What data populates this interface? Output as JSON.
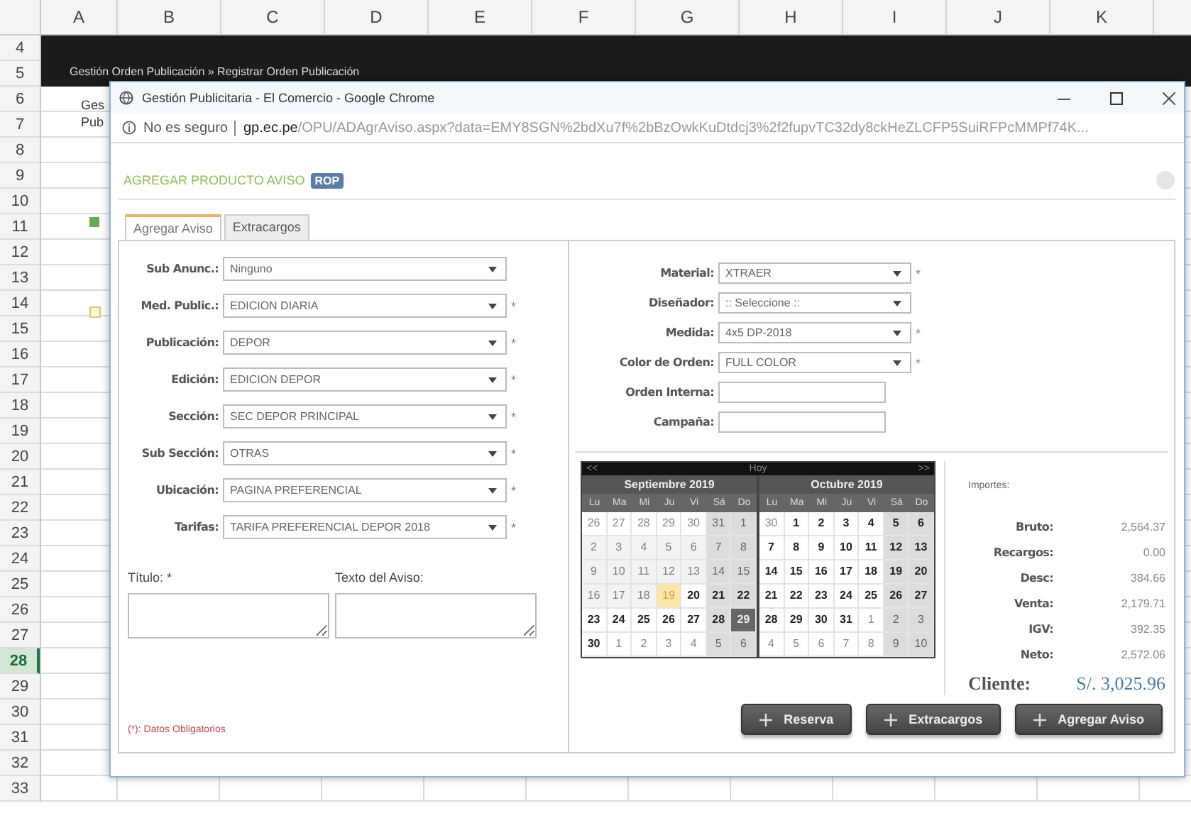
{
  "sheet": {
    "columns": [
      "A",
      "B",
      "C",
      "D",
      "E",
      "F",
      "G",
      "H",
      "I",
      "J",
      "K"
    ],
    "rows": [
      {
        "label": "4",
        "selected": false
      },
      {
        "label": "5",
        "selected": false
      },
      {
        "label": "6",
        "selected": false
      },
      {
        "label": "7",
        "selected": false
      },
      {
        "label": "8",
        "selected": false
      },
      {
        "label": "9",
        "selected": false
      },
      {
        "label": "10",
        "selected": false
      },
      {
        "label": "11",
        "selected": false
      },
      {
        "label": "12",
        "selected": false
      },
      {
        "label": "13",
        "selected": false
      },
      {
        "label": "14",
        "selected": false
      },
      {
        "label": "15",
        "selected": false
      },
      {
        "label": "16",
        "selected": false
      },
      {
        "label": "17",
        "selected": false
      },
      {
        "label": "18",
        "selected": false
      },
      {
        "label": "19",
        "selected": false
      },
      {
        "label": "20",
        "selected": false
      },
      {
        "label": "21",
        "selected": false
      },
      {
        "label": "22",
        "selected": false
      },
      {
        "label": "23",
        "selected": false
      },
      {
        "label": "24",
        "selected": false
      },
      {
        "label": "25",
        "selected": false
      },
      {
        "label": "26",
        "selected": false
      },
      {
        "label": "27",
        "selected": false
      },
      {
        "label": "28",
        "selected": true
      },
      {
        "label": "29",
        "selected": false
      },
      {
        "label": "30",
        "selected": false
      },
      {
        "label": "31",
        "selected": false
      },
      {
        "label": "32",
        "selected": false
      },
      {
        "label": "33",
        "selected": false
      }
    ]
  },
  "background_page": {
    "breadcrumb": "Gestión Orden Publicación » Registrar Orden Publicación",
    "lines": [
      "Ges",
      "Pub"
    ]
  },
  "browser": {
    "title": "Gestión Publicitaria - El Comercio - Google Chrome",
    "security": "No es seguro",
    "url_host": "gp.ec.pe",
    "url_path": "/OPU/ADAgrAviso.aspx?data=EMY8SGN%2bdXu7f%2bBzOwkKuDtdcj3%2f2fupvTC32dy8ckHeZLCFP5SuiRFPcMMPf74K..."
  },
  "page": {
    "title": "AGREGAR PRODUCTO AVISO",
    "badge": "ROP",
    "tabs": [
      {
        "label": "Agregar Aviso",
        "selected": true
      },
      {
        "label": "Extracargos",
        "selected": false
      }
    ],
    "left_fields": [
      {
        "label": "Sub Anunc.:",
        "value": "Ninguno"
      },
      {
        "label": "Med. Public.:",
        "value": "EDICION DIARIA",
        "required_mark": "*"
      },
      {
        "label": "Publicación:",
        "value": "DEPOR",
        "required_mark": "*"
      },
      {
        "label": "Edición:",
        "value": "EDICION DEPOR",
        "required_mark": "*"
      },
      {
        "label": "Sección:",
        "value": "SEC DEPOR PRINCIPAL",
        "required_mark": "*"
      },
      {
        "label": "Sub Sección:",
        "value": "OTRAS",
        "required_mark": "*"
      },
      {
        "label": "Ubicación:",
        "value": "PAGINA PREFERENCIAL",
        "required_mark": "*"
      },
      {
        "label": "Tarifas:",
        "value": "TARIFA PREFERENCIAL DEPOR 2018",
        "required_mark": "*"
      }
    ],
    "text_fields": [
      {
        "label": "Título: *"
      },
      {
        "label": "Texto del Aviso:"
      }
    ],
    "required_note": "(*): Datos Obligatorios",
    "right_fields": [
      {
        "kind": "select",
        "label": "Material:",
        "value": "XTRAER",
        "required_mark": "*"
      },
      {
        "kind": "select",
        "label": "Diseñador:",
        "value": ":: Seleccione ::"
      },
      {
        "kind": "select",
        "label": "Medida:",
        "value": "4x5 DP-2018",
        "required_mark": "*"
      },
      {
        "kind": "select",
        "label": "Color de Orden:",
        "value": "FULL COLOR",
        "required_mark": "*"
      },
      {
        "kind": "input",
        "label": "Orden Interna:"
      },
      {
        "kind": "input",
        "label": "Campaña:"
      }
    ]
  },
  "calendar": {
    "prev": "<<",
    "today": "Hoy",
    "next": ">>",
    "months": [
      {
        "title": "Septiembre 2019",
        "weekdays": [
          "Lu",
          "Ma",
          "Mi",
          "Ju",
          "Vi",
          "Sá",
          "Do"
        ],
        "weeks": [
          [
            {
              "day": "26",
              "kind": "other"
            },
            {
              "day": "27",
              "kind": "other"
            },
            {
              "day": "28",
              "kind": "other"
            },
            {
              "day": "29",
              "kind": "other"
            },
            {
              "day": "30",
              "kind": "other"
            },
            {
              "day": "31",
              "kind": "other"
            },
            {
              "day": "1",
              "kind": "disabled"
            }
          ],
          [
            {
              "day": "2",
              "kind": "disabled"
            },
            {
              "day": "3",
              "kind": "disabled"
            },
            {
              "day": "4",
              "kind": "disabled"
            },
            {
              "day": "5",
              "kind": "disabled"
            },
            {
              "day": "6",
              "kind": "disabled"
            },
            {
              "day": "7",
              "kind": "disabled"
            },
            {
              "day": "8",
              "kind": "disabled"
            }
          ],
          [
            {
              "day": "9",
              "kind": "disabled"
            },
            {
              "day": "10",
              "kind": "disabled"
            },
            {
              "day": "11",
              "kind": "disabled"
            },
            {
              "day": "12",
              "kind": "disabled"
            },
            {
              "day": "13",
              "kind": "disabled"
            },
            {
              "day": "14",
              "kind": "disabled"
            },
            {
              "day": "15",
              "kind": "disabled"
            }
          ],
          [
            {
              "day": "16",
              "kind": "disabled"
            },
            {
              "day": "17",
              "kind": "disabled"
            },
            {
              "day": "18",
              "kind": "disabled"
            },
            {
              "day": "19",
              "kind": "today"
            },
            {
              "day": "20",
              "kind": "enabled"
            },
            {
              "day": "21",
              "kind": "enabled"
            },
            {
              "day": "22",
              "kind": "enabled"
            }
          ],
          [
            {
              "day": "23",
              "kind": "enabled"
            },
            {
              "day": "24",
              "kind": "enabled"
            },
            {
              "day": "25",
              "kind": "enabled"
            },
            {
              "day": "26",
              "kind": "enabled"
            },
            {
              "day": "27",
              "kind": "enabled"
            },
            {
              "day": "28",
              "kind": "enabled"
            },
            {
              "day": "29",
              "kind": "selected"
            }
          ],
          [
            {
              "day": "30",
              "kind": "enabled"
            },
            {
              "day": "1",
              "kind": "other"
            },
            {
              "day": "2",
              "kind": "other"
            },
            {
              "day": "3",
              "kind": "other"
            },
            {
              "day": "4",
              "kind": "other"
            },
            {
              "day": "5",
              "kind": "other"
            },
            {
              "day": "6",
              "kind": "other"
            }
          ]
        ]
      },
      {
        "title": "Octubre 2019",
        "weekdays": [
          "Lu",
          "Ma",
          "Mi",
          "Ju",
          "Vi",
          "Sá",
          "Do"
        ],
        "weeks": [
          [
            {
              "day": "30",
              "kind": "other"
            },
            {
              "day": "1",
              "kind": "enabled"
            },
            {
              "day": "2",
              "kind": "enabled"
            },
            {
              "day": "3",
              "kind": "enabled"
            },
            {
              "day": "4",
              "kind": "enabled"
            },
            {
              "day": "5",
              "kind": "enabled"
            },
            {
              "day": "6",
              "kind": "enabled"
            }
          ],
          [
            {
              "day": "7",
              "kind": "enabled"
            },
            {
              "day": "8",
              "kind": "enabled"
            },
            {
              "day": "9",
              "kind": "enabled"
            },
            {
              "day": "10",
              "kind": "enabled"
            },
            {
              "day": "11",
              "kind": "enabled"
            },
            {
              "day": "12",
              "kind": "enabled"
            },
            {
              "day": "13",
              "kind": "enabled"
            }
          ],
          [
            {
              "day": "14",
              "kind": "enabled"
            },
            {
              "day": "15",
              "kind": "enabled"
            },
            {
              "day": "16",
              "kind": "enabled"
            },
            {
              "day": "17",
              "kind": "enabled"
            },
            {
              "day": "18",
              "kind": "enabled"
            },
            {
              "day": "19",
              "kind": "enabled"
            },
            {
              "day": "20",
              "kind": "enabled"
            }
          ],
          [
            {
              "day": "21",
              "kind": "enabled"
            },
            {
              "day": "22",
              "kind": "enabled"
            },
            {
              "day": "23",
              "kind": "enabled"
            },
            {
              "day": "24",
              "kind": "enabled"
            },
            {
              "day": "25",
              "kind": "enabled"
            },
            {
              "day": "26",
              "kind": "enabled"
            },
            {
              "day": "27",
              "kind": "enabled"
            }
          ],
          [
            {
              "day": "28",
              "kind": "enabled"
            },
            {
              "day": "29",
              "kind": "enabled"
            },
            {
              "day": "30",
              "kind": "enabled"
            },
            {
              "day": "31",
              "kind": "enabled"
            },
            {
              "day": "1",
              "kind": "other"
            },
            {
              "day": "2",
              "kind": "other"
            },
            {
              "day": "3",
              "kind": "other"
            }
          ],
          [
            {
              "day": "4",
              "kind": "other"
            },
            {
              "day": "5",
              "kind": "other"
            },
            {
              "day": "6",
              "kind": "other"
            },
            {
              "day": "7",
              "kind": "other"
            },
            {
              "day": "8",
              "kind": "other"
            },
            {
              "day": "9",
              "kind": "other"
            },
            {
              "day": "10",
              "kind": "other"
            }
          ]
        ]
      }
    ]
  },
  "totals": {
    "heading": "Importes:",
    "rows": [
      {
        "label": "Bruto:",
        "value": "2,564.37"
      },
      {
        "label": "Recargos:",
        "value": "0.00"
      },
      {
        "label": "Desc:",
        "value": "384.66"
      },
      {
        "label": "Venta:",
        "value": "2,179.71"
      },
      {
        "label": "IGV:",
        "value": "392.35"
      },
      {
        "label": "Neto:",
        "value": "2,572.06"
      }
    ],
    "client_label": "Cliente:",
    "client_value": "S/. 3,025.96"
  },
  "buttons": [
    {
      "label": "Reserva"
    },
    {
      "label": "Extracargos"
    },
    {
      "label": "Agregar Aviso"
    }
  ]
}
